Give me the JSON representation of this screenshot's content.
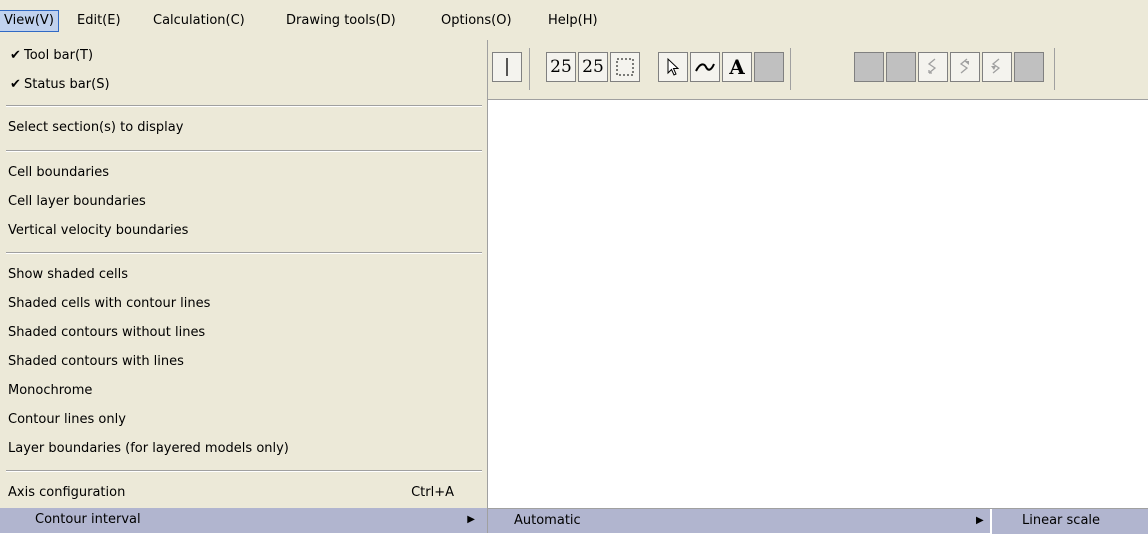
{
  "menubar": {
    "items": [
      "View(V)",
      "Edit(E)",
      "Calculation(C)",
      "Drawing tools(D)",
      "Options(O)",
      "Help(H)"
    ]
  },
  "toolbar": {
    "number_a": "25",
    "number_b": "25",
    "text_tool": "A"
  },
  "view_menu": {
    "checks": {
      "tool_bar": "✔",
      "status_bar": "✔"
    },
    "tool_bar": "Tool bar(T)",
    "status_bar": "Status bar(S)",
    "select_sections": "Select section(s) to display",
    "cell_boundaries": "Cell boundaries",
    "cell_layer_boundaries": "Cell layer boundaries",
    "vertical_velocity_boundaries": "Vertical velocity boundaries",
    "show_shaded_cells": "Show shaded cells",
    "shaded_cells_with_contour_lines": "Shaded cells with contour lines",
    "shaded_contours_without_lines": "Shaded contours without lines",
    "shaded_contours_with_lines": "Shaded contours with lines",
    "monochrome": "Monochrome",
    "contour_lines_only": "Contour lines only",
    "layer_boundaries": "Layer boundaries (for layered models only)",
    "axis_configuration": "Axis configuration",
    "axis_configuration_shortcut": "Ctrl+A",
    "contour_interval": "Contour interval"
  },
  "contour_submenu": {
    "automatic": "Automatic",
    "linear_scale": "Linear scale"
  },
  "arrow_glyph": "▶"
}
